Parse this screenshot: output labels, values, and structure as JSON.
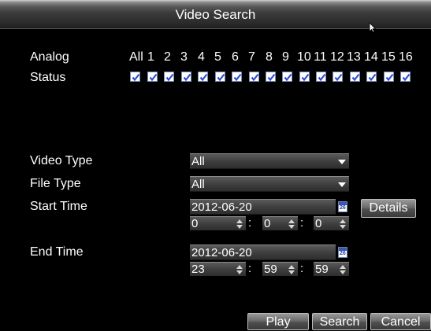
{
  "window": {
    "title": "Video Search"
  },
  "analog": {
    "label": "Analog",
    "status_label": "Status",
    "all_label": "All",
    "channels": [
      "1",
      "2",
      "3",
      "4",
      "5",
      "6",
      "7",
      "8",
      "9",
      "10",
      "11",
      "12",
      "13",
      "14",
      "15",
      "16"
    ],
    "checked": [
      true,
      true,
      true,
      true,
      true,
      true,
      true,
      true,
      true,
      true,
      true,
      true,
      true,
      true,
      true,
      true,
      true
    ]
  },
  "video_type": {
    "label": "Video Type",
    "value": "All"
  },
  "file_type": {
    "label": "File Type",
    "value": "All"
  },
  "start_time": {
    "label": "Start Time",
    "date": "2012-06-20",
    "hour": "0",
    "minute": "0",
    "second": "0",
    "calendar_day": "26",
    "details_label": "Details"
  },
  "end_time": {
    "label": "End Time",
    "date": "2012-06-20",
    "hour": "23",
    "minute": "59",
    "second": "59",
    "calendar_day": "26"
  },
  "buttons": {
    "play": "Play",
    "search": "Search",
    "cancel": "Cancel"
  },
  "colors": {
    "background": "#000000",
    "text": "#ffffff",
    "check": "#2f4fd0"
  },
  "icons": {
    "cursor": "mouse-pointer-icon",
    "calendar": "calendar-icon",
    "dropdown": "chevron-down-icon",
    "spinner": "spinner-arrows-icon",
    "checkbox": "checkbox-checked-icon"
  }
}
